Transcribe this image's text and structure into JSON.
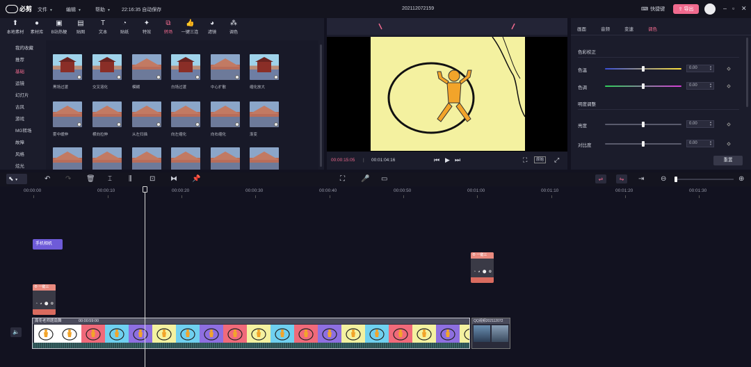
{
  "topbar": {
    "logo": "必剪",
    "menus": [
      "文件",
      "编辑",
      "帮助"
    ],
    "autosave": "22:16:35 自动保存",
    "project_name": "202112072159",
    "shortcut": "快捷键",
    "export": "导出"
  },
  "toolbox": {
    "tools": [
      "本地素材",
      "素材库",
      "B站热梗",
      "贴图",
      "文本",
      "贴纸",
      "特效",
      "转场",
      "一键三连",
      "滤镜",
      "调色"
    ],
    "active": "转场"
  },
  "categories": {
    "items": [
      "我的收藏",
      "推荐",
      "基础",
      "运镜",
      "幻灯片",
      "古风",
      "游戏",
      "MG转场",
      "故障",
      "风格",
      "炫光"
    ],
    "active": "基础"
  },
  "transitions": {
    "row1": [
      "黑场过渡",
      "交叉溶化",
      "模糊",
      "白场过渡",
      "中心扩散",
      "缩化放大"
    ],
    "row2": [
      "雾中缓伸",
      "横向拉伸",
      "从左扫描",
      "向左缩化",
      "向右缩化",
      "渐变"
    ]
  },
  "preview": {
    "current_time": "00:00:15:05",
    "total_time": "00:01:04:16",
    "ratio": "原始"
  },
  "right_panel": {
    "tabs": [
      "画面",
      "音频",
      "变速",
      "调色"
    ],
    "active_tab": "调色",
    "section_color": "色彩校正",
    "section_light": "明度调整",
    "rows": [
      {
        "label": "色温",
        "value": "0.00",
        "level": 0.5,
        "color": "temp"
      },
      {
        "label": "色调",
        "value": "0.00",
        "level": 0.5,
        "color": "tint"
      },
      {
        "label": "亮度",
        "value": "0.00",
        "level": 0.5,
        "color": "plain"
      },
      {
        "label": "对比度",
        "value": "0.00",
        "level": 0.5,
        "color": "plain"
      }
    ],
    "reset": "重置"
  },
  "timeline": {
    "ticks": [
      "00:00:00",
      "00:00:10",
      "00:00:20",
      "00:00:30",
      "00:00:40",
      "00:00:50",
      "00:01:00",
      "00:01:10",
      "00:01:20",
      "00:01:30"
    ],
    "chip_label": "手机相机",
    "fx_label": "一键三",
    "main_clip_title": "周冬老师题扇舞",
    "main_clip_duration": "00:00:59:00",
    "second_clip_title": "QQ视频202112072",
    "zoom_level": 0.0
  },
  "colors": {
    "accent": "#f06a8e",
    "panel": "#1b1c2b",
    "background": "#121220"
  }
}
